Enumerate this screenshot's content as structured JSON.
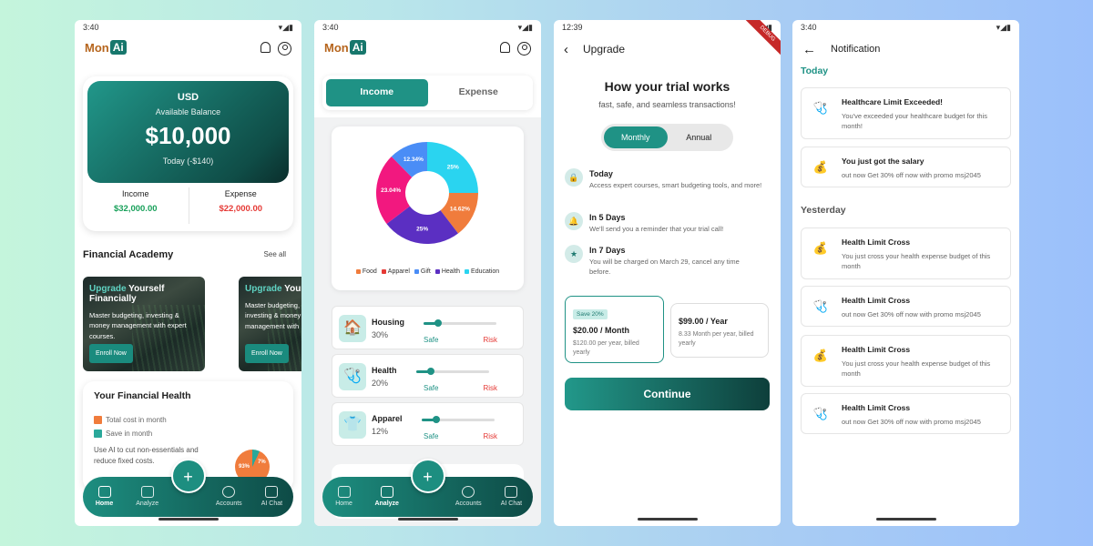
{
  "common": {
    "time1": "3:40",
    "time3": "12:39",
    "logo_mon": "Mon",
    "logo_ai": "Ai"
  },
  "home": {
    "currency": "USD",
    "available_label": "Available Balance",
    "balance": "$10,000",
    "today": "Today (-$140)",
    "income_label": "Income",
    "income_value": "$32,000.00",
    "expense_label": "Expense",
    "expense_value": "$22,000.00",
    "academy_title": "Financial Academy",
    "see_all": "See all",
    "course1": {
      "title_hl": "Upgrade",
      "title_rest": " Yourself Financially",
      "desc": "Master budgeting, investing & money management with expert courses.",
      "button": "Enroll Now"
    },
    "course2": {
      "title_hl": "Upgrade",
      "title_rest": " Your",
      "desc": "Master budgeting, investing & money management with",
      "button": "Enroll Now"
    },
    "health_title": "Your Financial Health",
    "legend_total": "Total cost in month",
    "legend_save": "Save in month",
    "note": "Use AI to cut non-essentials and reduce fixed costs.",
    "mini_pie_a": "93%",
    "mini_pie_b": "7%",
    "colors": {
      "total": "#f07c3c",
      "save": "#2aa89a"
    }
  },
  "nav": {
    "home": "Home",
    "analyze": "Analyze",
    "accounts": "Accounts",
    "ai_chat": "AI Chat",
    "fab": "+"
  },
  "analyze": {
    "tab_income": "Income",
    "tab_expense": "Expense",
    "slices": [
      {
        "label": "Food",
        "value": 14.62,
        "color": "#f07c3c"
      },
      {
        "label": "Apparel",
        "value": 0.01,
        "color": "#e53935"
      },
      {
        "label": "Gift",
        "value": 12.34,
        "color": "#4a8df6"
      },
      {
        "label": "Health",
        "value": 25,
        "color": "#5b2fc2"
      },
      {
        "label": "Education",
        "value": 25,
        "color": "#2ad4f0"
      },
      {
        "label": "",
        "value": 23.04,
        "color": "#f2187f"
      }
    ],
    "slice_labels": [
      "25%",
      "14.62%",
      "25%",
      "23.04%",
      "12.34%"
    ],
    "legend": [
      "Food",
      "Apparel",
      "Gift",
      "Health",
      "Education"
    ],
    "categories": [
      {
        "name": "Housing",
        "pct": "30%",
        "level": 0.2,
        "icon": "🏠"
      },
      {
        "name": "Health",
        "pct": "20%",
        "level": 0.2,
        "icon": "🩺"
      },
      {
        "name": "Apparel",
        "pct": "12%",
        "level": 0.2,
        "icon": "👕"
      }
    ],
    "safe": "Safe",
    "risk": "Risk"
  },
  "upgrade": {
    "title": "Upgrade",
    "ribbon": "DEBUG",
    "heading": "How your trial works",
    "sub": "fast, safe, and seamless transactions!",
    "monthly": "Monthly",
    "annual": "Annual",
    "steps": [
      {
        "title": "Today",
        "desc": "Access expert courses, smart budgeting tools, and more!",
        "icon": "🔒"
      },
      {
        "title": "In 5 Days",
        "desc": "We'll send you a reminder that your trial call!",
        "icon": "🔔"
      },
      {
        "title": "In 7 Days",
        "desc": "You will be charged on March 29, cancel any time before.",
        "icon": "★"
      }
    ],
    "plan1": {
      "badge": "Save 20%",
      "price": "$20.00 / Month",
      "desc": "$120.00 per year, billed yearly"
    },
    "plan2": {
      "price": "$99.00 / Year",
      "desc": "8.33 Month per year, billed yearly"
    },
    "cta": "Continue"
  },
  "notif": {
    "title": "Notification",
    "today": "Today",
    "yesterday": "Yesterday",
    "items": [
      {
        "title": "Healthcare Limit Exceeded!",
        "desc": "You've exceeded your healthcare budget for this month!",
        "icon": "🩺"
      },
      {
        "title": "You just got the salary",
        "desc": "out now Get 30% off now with promo msj2045",
        "icon": "💰"
      },
      {
        "title": "Health Limit Cross",
        "desc": "You just cross your health expense budget of this month",
        "icon": "💰"
      },
      {
        "title": "Health Limit Cross",
        "desc": "out now Get 30% off now with promo msj2045",
        "icon": "🩺"
      },
      {
        "title": "Health Limit Cross",
        "desc": "You just cross your health expense budget of this month",
        "icon": "💰"
      },
      {
        "title": "Health Limit Cross",
        "desc": "out now Get 30% off now with promo msj2045",
        "icon": "🩺"
      }
    ]
  }
}
